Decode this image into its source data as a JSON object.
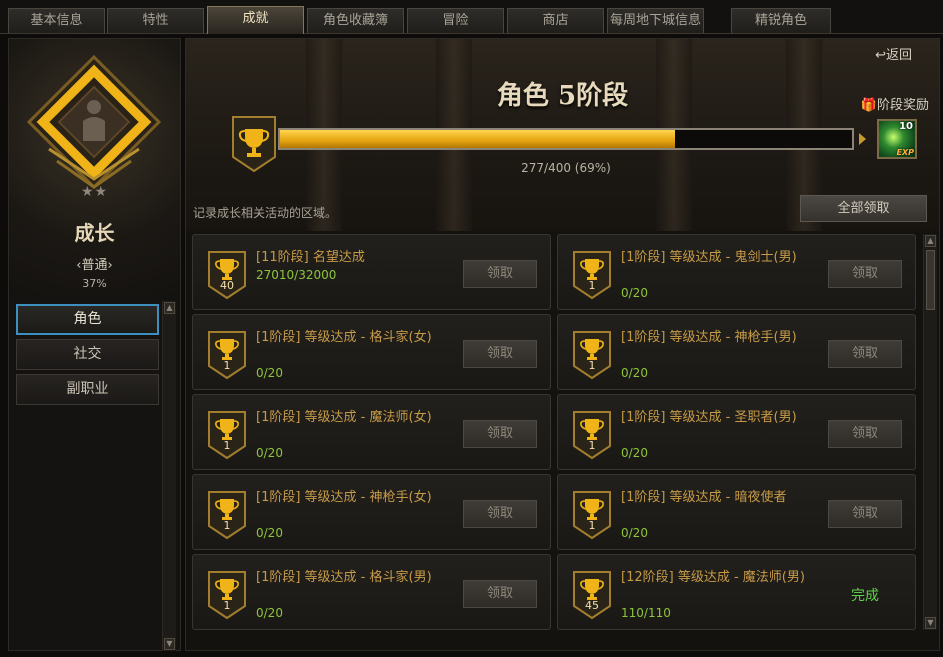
{
  "tabs": [
    {
      "label": "基本信息",
      "active": false
    },
    {
      "label": "特性",
      "active": false
    },
    {
      "label": "成就",
      "active": true
    },
    {
      "label": "角色收藏簿",
      "active": false
    },
    {
      "label": "冒险",
      "active": false
    },
    {
      "label": "商店",
      "active": false
    },
    {
      "label": "每周地下城信息",
      "active": false
    },
    {
      "label": "精锐角色",
      "active": false
    }
  ],
  "sidebar": {
    "stars": "★★",
    "title": "成长",
    "grade": "‹普通›",
    "percent": "37%",
    "nav": [
      {
        "label": "角色",
        "active": true
      },
      {
        "label": "社交",
        "active": false
      },
      {
        "label": "副职业",
        "active": false
      }
    ]
  },
  "main": {
    "back_label": "返回",
    "stage_title": "角色 5阶段",
    "progress": {
      "current": 277,
      "total": 400,
      "fraction": 0.69,
      "text": "277/400 (69%)"
    },
    "reward_label": "阶段奖励",
    "reward_count": "10",
    "reward_tag": "EXP",
    "hint": "记录成长相关活动的区域。",
    "claim_all_label": "全部领取",
    "cards": [
      {
        "badge": "40",
        "title": "[11阶段] 名望达成",
        "progress": "27010/32000",
        "action": "领取",
        "done": false
      },
      {
        "badge": "1",
        "title": "[1阶段] 等级达成 - 鬼剑士(男)",
        "progress": "0/20",
        "action": "领取",
        "done": false
      },
      {
        "badge": "1",
        "title": "[1阶段] 等级达成 - 格斗家(女)",
        "progress": "0/20",
        "action": "领取",
        "done": false
      },
      {
        "badge": "1",
        "title": "[1阶段] 等级达成 - 神枪手(男)",
        "progress": "0/20",
        "action": "领取",
        "done": false
      },
      {
        "badge": "1",
        "title": "[1阶段] 等级达成 - 魔法师(女)",
        "progress": "0/20",
        "action": "领取",
        "done": false
      },
      {
        "badge": "1",
        "title": "[1阶段] 等级达成 - 圣职者(男)",
        "progress": "0/20",
        "action": "领取",
        "done": false
      },
      {
        "badge": "1",
        "title": "[1阶段] 等级达成 - 神枪手(女)",
        "progress": "0/20",
        "action": "领取",
        "done": false
      },
      {
        "badge": "1",
        "title": "[1阶段] 等级达成 - 暗夜使者",
        "progress": "0/20",
        "action": "领取",
        "done": false
      },
      {
        "badge": "1",
        "title": "[1阶段] 等级达成 - 格斗家(男)",
        "progress": "0/20",
        "action": "领取",
        "done": false
      },
      {
        "badge": "45",
        "title": "[12阶段] 等级达成 - 魔法师(男)",
        "progress": "110/110",
        "action": "完成",
        "done": true
      }
    ]
  },
  "colors": {
    "accent_gold": "#f0b418",
    "progress_green": "#8dc43a",
    "done_green": "#5ed04c",
    "selected_blue": "#3d8fbf"
  }
}
